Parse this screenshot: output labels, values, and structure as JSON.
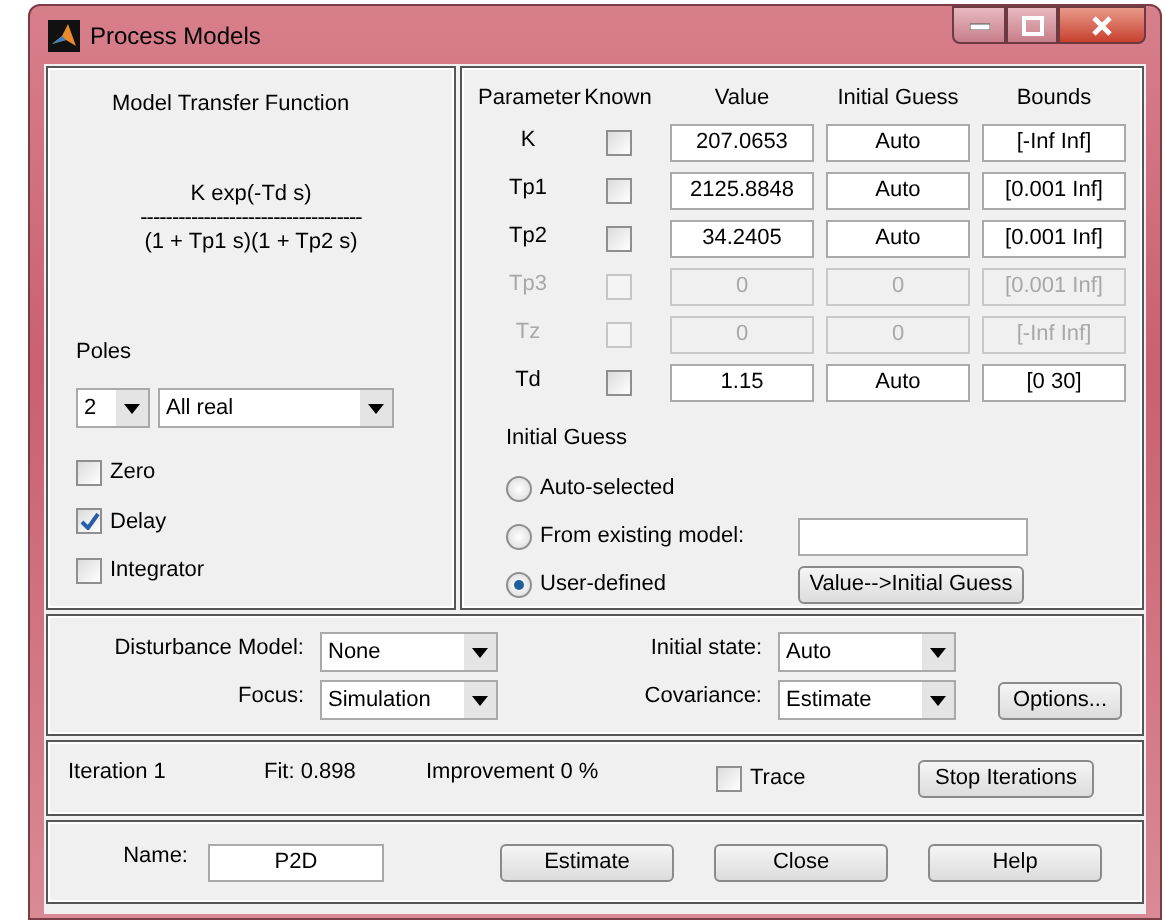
{
  "window": {
    "title": "Process Models"
  },
  "model_panel": {
    "title": "Model Transfer Function",
    "numerator": "K exp(-Td s)",
    "fraction_line": "-----------------------------------",
    "denominator": "(1 + Tp1 s)(1 + Tp2 s)",
    "poles_label": "Poles",
    "poles_count": "2",
    "poles_type": "All real",
    "options": [
      {
        "label": "Zero",
        "checked": false
      },
      {
        "label": "Delay",
        "checked": true
      },
      {
        "label": "Integrator",
        "checked": false
      }
    ]
  },
  "parameter_panel": {
    "columns": [
      "Parameter",
      "Known",
      "Value",
      "Initial Guess",
      "Bounds"
    ],
    "rows": [
      {
        "name": "K",
        "known": false,
        "disabled": false,
        "value": "207.0653",
        "initial_guess": "Auto",
        "bounds": "[-Inf Inf]"
      },
      {
        "name": "Tp1",
        "known": false,
        "disabled": false,
        "value": "2125.8848",
        "initial_guess": "Auto",
        "bounds": "[0.001 Inf]"
      },
      {
        "name": "Tp2",
        "known": false,
        "disabled": false,
        "value": "34.2405",
        "initial_guess": "Auto",
        "bounds": "[0.001 Inf]"
      },
      {
        "name": "Tp3",
        "known": false,
        "disabled": true,
        "value": "0",
        "initial_guess": "0",
        "bounds": "[0.001 Inf]"
      },
      {
        "name": "Tz",
        "known": false,
        "disabled": true,
        "value": "0",
        "initial_guess": "0",
        "bounds": "[-Inf Inf]"
      },
      {
        "name": "Td",
        "known": false,
        "disabled": false,
        "value": "1.15",
        "initial_guess": "Auto",
        "bounds": "[0 30]"
      }
    ],
    "initial_guess_label": "Initial Guess",
    "initial_guess_options": [
      {
        "label": "Auto-selected",
        "selected": false
      },
      {
        "label": "From existing model:",
        "selected": false
      },
      {
        "label": "User-defined",
        "selected": true
      }
    ],
    "copy_button": "Value-->Initial Guess"
  },
  "estimation_panel": {
    "disturbance_model": {
      "label": "Disturbance Model:",
      "value": "None"
    },
    "focus": {
      "label": "Focus:",
      "value": "Simulation"
    },
    "initial_state": {
      "label": "Initial state:",
      "value": "Auto"
    },
    "covariance": {
      "label": "Covariance:",
      "value": "Estimate"
    },
    "options_button": "Options..."
  },
  "iteration_panel": {
    "iteration": "Iteration 1",
    "fit": "Fit: 0.898",
    "improvement": "Improvement 0 %",
    "trace": {
      "label": "Trace",
      "checked": false
    },
    "stop_button": "Stop Iterations"
  },
  "footer": {
    "name_label": "Name:",
    "name_value": "P2D",
    "buttons": [
      "Estimate",
      "Close",
      "Help"
    ]
  }
}
